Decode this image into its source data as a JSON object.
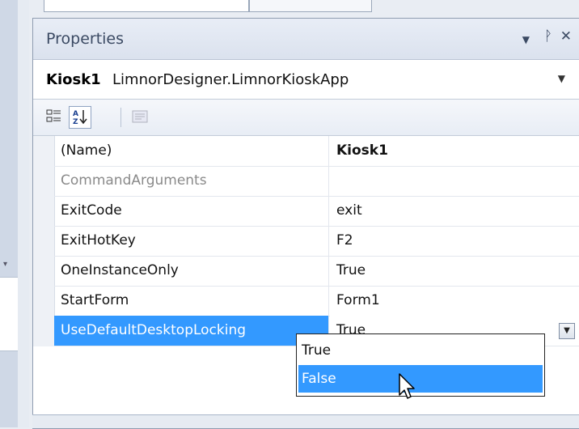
{
  "panel": {
    "title": "Properties",
    "object_name": "Kiosk1",
    "object_type": "LimnorDesigner.LimnorKioskApp"
  },
  "properties": [
    {
      "name": "(Name)",
      "value": "Kiosk1"
    },
    {
      "name": "CommandArguments",
      "value": ""
    },
    {
      "name": "ExitCode",
      "value": "exit"
    },
    {
      "name": "ExitHotKey",
      "value": "F2"
    },
    {
      "name": "OneInstanceOnly",
      "value": "True"
    },
    {
      "name": "StartForm",
      "value": "Form1"
    },
    {
      "name": "UseDefaultDesktopLocking",
      "value": "True"
    }
  ],
  "dropdown": {
    "options": [
      "True",
      "False"
    ],
    "highlighted": "False"
  },
  "icons": {
    "title_buttons": [
      "pin-dropdown-icon",
      "pushpin-icon",
      "close-icon"
    ],
    "toolbar": [
      "categorized-icon",
      "alphabetical-icon",
      "property-pages-icon"
    ]
  },
  "colors": {
    "selection": "#3399ff",
    "title_text": "#3b4a63"
  }
}
